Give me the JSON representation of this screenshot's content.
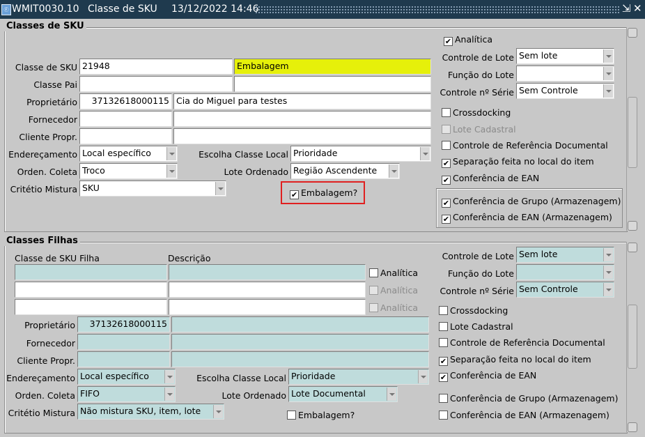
{
  "window": {
    "code": "WMIT0030.10",
    "name": "Classe de SKU",
    "datetime": "13/12/2022 14:46",
    "app_icon": "oracle-forms-icon",
    "minimize_glyph": "⇲",
    "close_glyph": "✕"
  },
  "sku": {
    "title": "Classes de SKU",
    "classe_label": "Classe de SKU",
    "classe_code": "21948",
    "classe_desc": "Embalagem",
    "pai_label": "Classe Pai",
    "pai_code": "",
    "pai_desc": "",
    "prop_label": "Proprietário",
    "prop_code": "37132618000115",
    "prop_desc": "Cia do Miguel para testes",
    "forn_label": "Fornecedor",
    "forn_code": "",
    "forn_desc": "",
    "cli_label": "Cliente Propr.",
    "cli_code": "",
    "cli_desc": "",
    "end_label": "Endereçamento",
    "end_value": "Local específico",
    "ord_label": "Orden. Coleta",
    "ord_value": "Troco",
    "crit_label": "Critétio Mistura",
    "crit_value": "SKU",
    "esc_label": "Escolha Classe Local",
    "esc_value": "Prioridade",
    "lote_ord_label": "Lote Ordenado",
    "lote_ord_value": "Região Ascendente",
    "emb_label": "Embalagem?",
    "emb_checked": "✔",
    "analitica_label": "Analítica",
    "analitica_checked": "✔",
    "ctrl_lote_label": "Controle de Lote",
    "ctrl_lote_value": "Sem lote",
    "funcao_lote_label": "Função do Lote",
    "funcao_lote_value": "",
    "ctrl_serie_label": "Controle nº Série",
    "ctrl_serie_value": "Sem Controle",
    "crossdocking_label": "Crossdocking",
    "lote_cad_label": "Lote Cadastral",
    "ctrl_ref_label": "Controle de Referência Documental",
    "separacao_label": "Separação feita no local do item",
    "separacao_checked": "✔",
    "conf_ean_label": "Conferência de EAN",
    "conf_ean_checked": "✔",
    "conf_grupo_label": "Conferência de Grupo (Armazenagem)",
    "conf_grupo_checked": "✔",
    "conf_ean_arm_label": "Conferência de EAN (Armazenagem)",
    "conf_ean_arm_checked": "✔"
  },
  "filhas": {
    "title": "Classes Filhas",
    "col_classe": "Classe de SKU Filha",
    "col_desc": "Descrição",
    "rows": [
      {
        "code": "",
        "desc": "",
        "analitica": "Analítica"
      },
      {
        "code": "",
        "desc": "",
        "analitica": "Analítica"
      },
      {
        "code": "",
        "desc": "",
        "analitica": "Analítica"
      }
    ],
    "prop_label": "Proprietário",
    "prop_code": "37132618000115",
    "prop_desc": "",
    "forn_label": "Fornecedor",
    "cli_label": "Cliente Propr.",
    "end_label": "Endereçamento",
    "end_value": "Local específico",
    "ord_label": "Orden. Coleta",
    "ord_value": "FIFO",
    "crit_label": "Critétio Mistura",
    "crit_value": "Não mistura SKU, item, lote",
    "esc_label": "Escolha Classe Local",
    "esc_value": "Prioridade",
    "lote_ord_label": "Lote Ordenado",
    "lote_ord_value": "Lote Documental",
    "emb_label": "Embalagem?",
    "ctrl_lote_label": "Controle de Lote",
    "ctrl_lote_value": "Sem lote",
    "funcao_lote_label": "Função do Lote",
    "ctrl_serie_label": "Controle nº Série",
    "ctrl_serie_value": "Sem Controle",
    "crossdocking_label": "Crossdocking",
    "lote_cad_label": "Lote Cadastral",
    "ctrl_ref_label": "Controle de Referência Documental",
    "separacao_label": "Separação feita no local do item",
    "separacao_checked": "✔",
    "conf_ean_label": "Conferência de EAN",
    "conf_ean_checked": "✔",
    "conf_grupo_label": "Conferência de Grupo (Armazenagem)",
    "conf_ean_arm_label": "Conferência de EAN (Armazenagem)"
  }
}
